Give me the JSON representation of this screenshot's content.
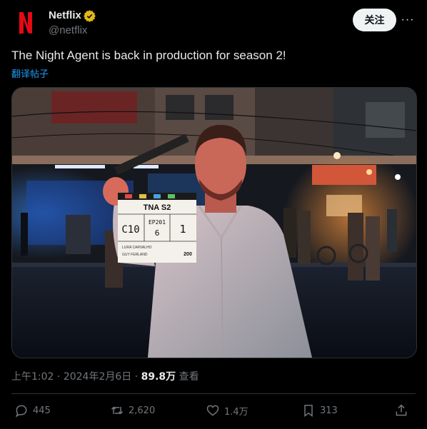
{
  "account": {
    "display_name": "Netflix",
    "handle": "@netflix",
    "verified_color": "#e2b719",
    "brand_color": "#e50914"
  },
  "header": {
    "follow_label": "关注",
    "more_label": "···"
  },
  "tweet": {
    "text": "The Night Agent is back in production for season 2!",
    "translate_label": "翻译帖子"
  },
  "media": {
    "clapper": {
      "title": "TNA S2",
      "scene": "C10",
      "episode": "EP201",
      "setup": "6",
      "take": "1",
      "director": "LURA CARVALHO",
      "dp": "GUY FERLAND",
      "roll": "200"
    }
  },
  "meta": {
    "time": "上午1:02",
    "sep1": " · ",
    "date": "2024年2月6日",
    "sep2": " · ",
    "views": "89.8万",
    "views_label": " 查看"
  },
  "actions": {
    "replies": "445",
    "retweets": "2,620",
    "likes": "1.4万",
    "bookmarks": "313"
  }
}
